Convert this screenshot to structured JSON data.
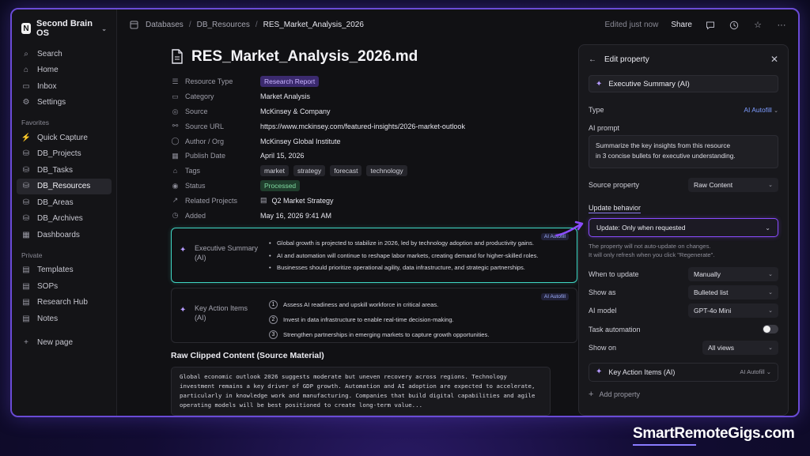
{
  "sidebar": {
    "workspace": "Second Brain OS",
    "top_items": [
      {
        "label": "Search",
        "icon": "search-icon"
      },
      {
        "label": "Home",
        "icon": "home-icon"
      },
      {
        "label": "Inbox",
        "icon": "inbox-icon"
      },
      {
        "label": "Settings",
        "icon": "gear-icon"
      }
    ],
    "favorites_label": "Favorites",
    "favorites": [
      {
        "label": "Quick Capture",
        "icon": "bolt-icon"
      },
      {
        "label": "DB_Projects",
        "icon": "database-icon"
      },
      {
        "label": "DB_Tasks",
        "icon": "database-icon"
      },
      {
        "label": "DB_Resources",
        "icon": "database-icon",
        "active": true
      },
      {
        "label": "DB_Areas",
        "icon": "database-icon"
      },
      {
        "label": "DB_Archives",
        "icon": "database-icon"
      },
      {
        "label": "Dashboards",
        "icon": "dashboard-icon"
      }
    ],
    "private_label": "Private",
    "private": [
      {
        "label": "Templates",
        "icon": "page-icon"
      },
      {
        "label": "SOPs",
        "icon": "page-icon"
      },
      {
        "label": "Research Hub",
        "icon": "page-icon"
      },
      {
        "label": "Notes",
        "icon": "page-icon"
      }
    ],
    "new_page": "New page"
  },
  "topbar": {
    "breadcrumb": [
      "Databases",
      "DB_Resources",
      "RES_Market_Analysis_2026"
    ],
    "edited": "Edited just now",
    "share": "Share"
  },
  "doc": {
    "title": "RES_Market_Analysis_2026.md",
    "props": {
      "resource_type": {
        "label": "Resource Type",
        "value": "Research Report"
      },
      "category": {
        "label": "Category",
        "value": "Market Analysis"
      },
      "source": {
        "label": "Source",
        "value": "McKinsey & Company"
      },
      "source_url": {
        "label": "Source URL",
        "value": "https://www.mckinsey.com/featured-insights/2026-market-outlook"
      },
      "author": {
        "label": "Author / Org",
        "value": "McKinsey Global Institute"
      },
      "publish_date": {
        "label": "Publish Date",
        "value": "April 15, 2026"
      },
      "tags": {
        "label": "Tags",
        "values": [
          "market",
          "strategy",
          "forecast",
          "technology"
        ]
      },
      "status": {
        "label": "Status",
        "value": "Processed"
      },
      "related": {
        "label": "Related Projects",
        "value": "Q2 Market Strategy"
      },
      "added": {
        "label": "Added",
        "value": "May 16, 2026 9:41 AM"
      }
    },
    "exec_summary": {
      "label": "Executive Summary (AI)",
      "badge": "AI Autofill",
      "bullets": [
        "Global growth is projected to stabilize in 2026, led by technology adoption and productivity gains.",
        "AI and automation will continue to reshape labor markets, creating demand for higher-skilled roles.",
        "Businesses should prioritize operational agility, data infrastructure, and strategic partnerships."
      ]
    },
    "key_actions": {
      "label": "Key Action Items (AI)",
      "badge": "AI Autofill",
      "items": [
        "Assess AI readiness and upskill workforce in critical areas.",
        "Invest in data infrastructure to enable real-time decision-making.",
        "Strengthen partnerships in emerging markets to capture growth opportunities."
      ]
    },
    "raw_heading": "Raw Clipped Content (Source Material)",
    "raw_lines": [
      "Global economic outlook 2026 suggests moderate but uneven recovery across regions. Technology",
      "investment remains a key driver of GDP growth. Automation and AI adoption are expected to accelerate,",
      "particularly in knowledge work and manufacturing. Companies that build digital capabilities and agile",
      "operating models will be best positioned to create long-term value..."
    ]
  },
  "panel": {
    "title": "Edit property",
    "name": "Executive Summary (AI)",
    "type_label": "Type",
    "type_value": "AI Autofill",
    "prompt_label": "AI prompt",
    "prompt_lines": [
      "Summarize the key insights from this resource",
      "in 3 concise bullets for executive understanding."
    ],
    "source_label": "Source property",
    "source_value": "Raw Content",
    "update_label": "Update behavior",
    "update_value": "Update: Only when requested",
    "note_lines": [
      "The property will not auto-update on changes.",
      "It will only refresh when you click \"Regenerate\"."
    ],
    "when_label": "When to update",
    "when_value": "Manually",
    "show_as_label": "Show as",
    "show_as_value": "Bulleted list",
    "model_label": "AI model",
    "model_value": "GPT-4o Mini",
    "task_label": "Task automation",
    "show_on_label": "Show on",
    "show_on_value": "All views",
    "other_prop": "Key Action Items (AI)",
    "other_prop_type": "AI Autofill",
    "add_property": "Add property"
  },
  "brand": "SmartRemoteGigs.com",
  "colors": {
    "accent": "#8a4cff",
    "highlight": "#3fd6c4",
    "frame": "#6a4bd6"
  }
}
